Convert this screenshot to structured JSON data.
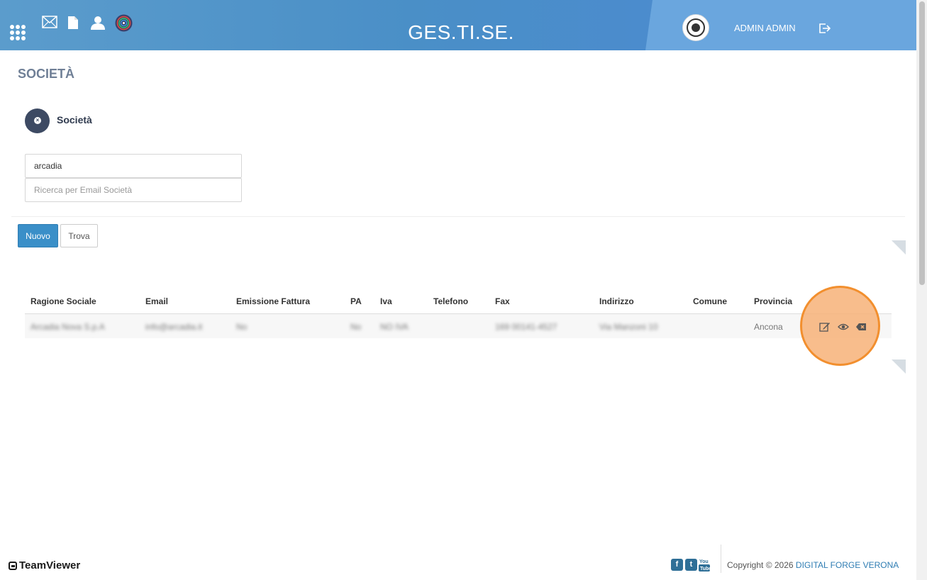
{
  "header": {
    "title": "GES.TI.SE.",
    "username": "ADMIN ADMIN",
    "icons": [
      "apps-grid-icon",
      "mail-icon",
      "document-icon",
      "user-icon",
      "fingerprint-icon",
      "logout-icon"
    ]
  },
  "page": {
    "title": "SOCIETÀ",
    "section_label": "Società"
  },
  "search": {
    "name_value": "arcadia",
    "email_placeholder": "Ricerca per Email Società"
  },
  "buttons": {
    "new_label": "Nuovo",
    "find_label": "Trova"
  },
  "table": {
    "columns": [
      "Ragione Sociale",
      "Email",
      "Emissione Fattura",
      "PA",
      "Iva",
      "Telefono",
      "Fax",
      "Indirizzo",
      "Comune",
      "Provincia"
    ],
    "rows": [
      {
        "ragione_sociale": "Arcadia Nova S.p.A",
        "email": "info@arcadia.it",
        "emissione_fattura": "No",
        "pa": "No",
        "iva": "NO IVA",
        "telefono": "",
        "fax": "169 00141-4527",
        "indirizzo": "Via Manzoni 10",
        "comune": "",
        "provincia": "Ancona"
      }
    ],
    "row_actions": [
      "edit-icon",
      "view-icon",
      "delete-icon"
    ]
  },
  "footer": {
    "brand": "TeamViewer",
    "social": [
      "facebook-icon",
      "twitter-icon",
      "youtube-icon"
    ],
    "copyright_text": "Copyright © 2026",
    "copyright_link": "DIGITAL FORGE VERONA"
  },
  "colors": {
    "header": "#4a8fc7",
    "primary_button": "#3a8fc8",
    "highlight": "#f28f2e",
    "section_icon": "#3d4a63"
  }
}
